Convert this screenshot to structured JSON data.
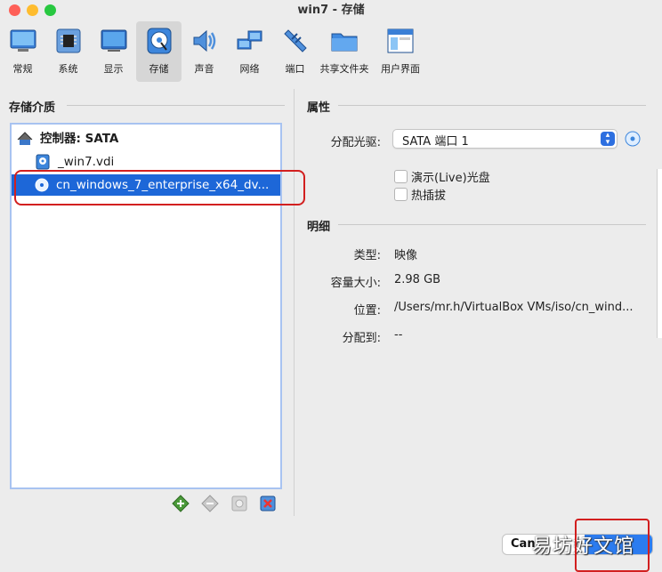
{
  "window": {
    "title": "win7 - 存储"
  },
  "toolbar": {
    "items": [
      {
        "label": "常规"
      },
      {
        "label": "系统"
      },
      {
        "label": "显示"
      },
      {
        "label": "存储"
      },
      {
        "label": "声音"
      },
      {
        "label": "网络"
      },
      {
        "label": "端口"
      },
      {
        "label": "共享文件夹"
      },
      {
        "label": "用户界面"
      }
    ]
  },
  "storage": {
    "title": "存储介质",
    "controller": "控制器: SATA",
    "items": [
      {
        "name": "_win7.vdi"
      },
      {
        "name": "cn_windows_7_enterprise_x64_dv..."
      }
    ]
  },
  "attributes": {
    "title": "属性",
    "optical_label": "分配光驱:",
    "optical_value": "SATA 端口 1",
    "live_cd_label": "演示(Live)光盘",
    "hotplug_label": "热插拔"
  },
  "details": {
    "title": "明细",
    "type_label": "类型:",
    "type_value": "映像",
    "size_label": "容量大小:",
    "size_value": "2.98 GB",
    "location_label": "位置:",
    "location_value": "/Users/mr.h/VirtualBox VMs/iso/cn_wind...",
    "attached_label": "分配到:",
    "attached_value": "--"
  },
  "footer": {
    "cancel_label": "Can",
    "watermark": "易坊好文馆"
  },
  "colors": {
    "selection": "#1d67d8",
    "highlight_red": "#d21f1f",
    "accent_blue": "#2d6fe0"
  }
}
